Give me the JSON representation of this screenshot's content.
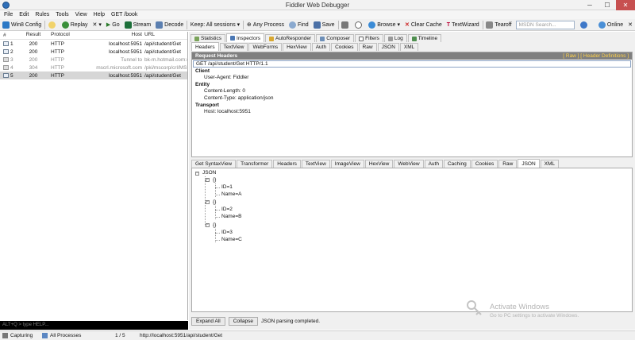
{
  "window": {
    "title": "Fiddler Web Debugger",
    "minimize": "─",
    "maximize": "☐",
    "close": "✕"
  },
  "menu": [
    "File",
    "Edit",
    "Rules",
    "Tools",
    "View",
    "Help",
    "GET /book"
  ],
  "toolbar": {
    "win8config": "Win8 Config",
    "replay": "Replay",
    "remove": "✕ ▾",
    "go": "Go",
    "stream": "Stream",
    "decode": "Decode",
    "keep": "Keep: All sessions ▾",
    "any_process": "Any Process",
    "find": "Find",
    "save": "Save",
    "browse": "Browse ▾",
    "clear_cache": "Clear Cache",
    "textwizard": "TextWizard",
    "tearoff": "Tearoff",
    "msdn_placeholder": "MSDN Search...",
    "online": "Online"
  },
  "sessions": {
    "headers": {
      "num": "#",
      "result": "Result",
      "protocol": "Protocol",
      "host": "Host",
      "url": "URL"
    },
    "rows": [
      {
        "num": "1",
        "result": "200",
        "protocol": "HTTP",
        "host": "localhost:5951",
        "url": "/api/student/Get"
      },
      {
        "num": "2",
        "result": "200",
        "protocol": "HTTP",
        "host": "localhost:5951",
        "url": "/api/student/Get"
      },
      {
        "num": "3",
        "result": "200",
        "protocol": "HTTP",
        "host": "Tunnel to",
        "url": "bk-m.hotmail.com:443"
      },
      {
        "num": "4",
        "result": "304",
        "protocol": "HTTP",
        "host": "mscrl.microsoft.com",
        "url": "/pki/mscorp/crl/MSIT%20"
      },
      {
        "num": "5",
        "result": "200",
        "protocol": "HTTP",
        "host": "localhost:5951",
        "url": "/api/student/Get"
      }
    ]
  },
  "quickexec": "ALT+Q > type HELP...",
  "status": {
    "capturing": "Capturing",
    "processes": "All Processes",
    "count": "1 / 5",
    "url": "http://localhost:5951/api/student/Get"
  },
  "top_tabs": [
    "Statistics",
    "Inspectors",
    "AutoResponder",
    "Composer",
    "Filters",
    "Log",
    "Timeline"
  ],
  "request": {
    "tabs": [
      "Headers",
      "TextView",
      "WebForms",
      "HexView",
      "Auth",
      "Cookies",
      "Raw",
      "JSON",
      "XML"
    ],
    "title": "Request Headers",
    "links": "[ Raw ]  [ Header Definitions ]",
    "line": "GET /api/student/Get HTTP/1.1",
    "groups": [
      {
        "name": "Client",
        "items": [
          "User-Agent: Fiddler"
        ]
      },
      {
        "name": "Entity",
        "items": [
          "Content-Length: 0",
          "Content-Type: application/json"
        ]
      },
      {
        "name": "Transport",
        "items": [
          "Host: localhost:5951"
        ]
      }
    ]
  },
  "response": {
    "tabs": [
      "Get SyntaxView",
      "Transformer",
      "Headers",
      "TextView",
      "ImageView",
      "HexView",
      "WebView",
      "Auth",
      "Caching",
      "Cookies",
      "Raw",
      "JSON",
      "XML"
    ],
    "tree": {
      "root": "JSON",
      "items": [
        {
          "label": "{}",
          "fields": [
            "ID=1",
            "Name=A"
          ]
        },
        {
          "label": "{}",
          "fields": [
            "ID=2",
            "Name=B"
          ]
        },
        {
          "label": "{}",
          "fields": [
            "ID=3",
            "Name=C"
          ]
        }
      ]
    },
    "expand_all": "Expand All",
    "collapse": "Collapse",
    "status": "JSON parsing completed."
  },
  "watermark": {
    "title": "Activate Windows",
    "subtitle": "Go to PC settings to activate Windows."
  }
}
